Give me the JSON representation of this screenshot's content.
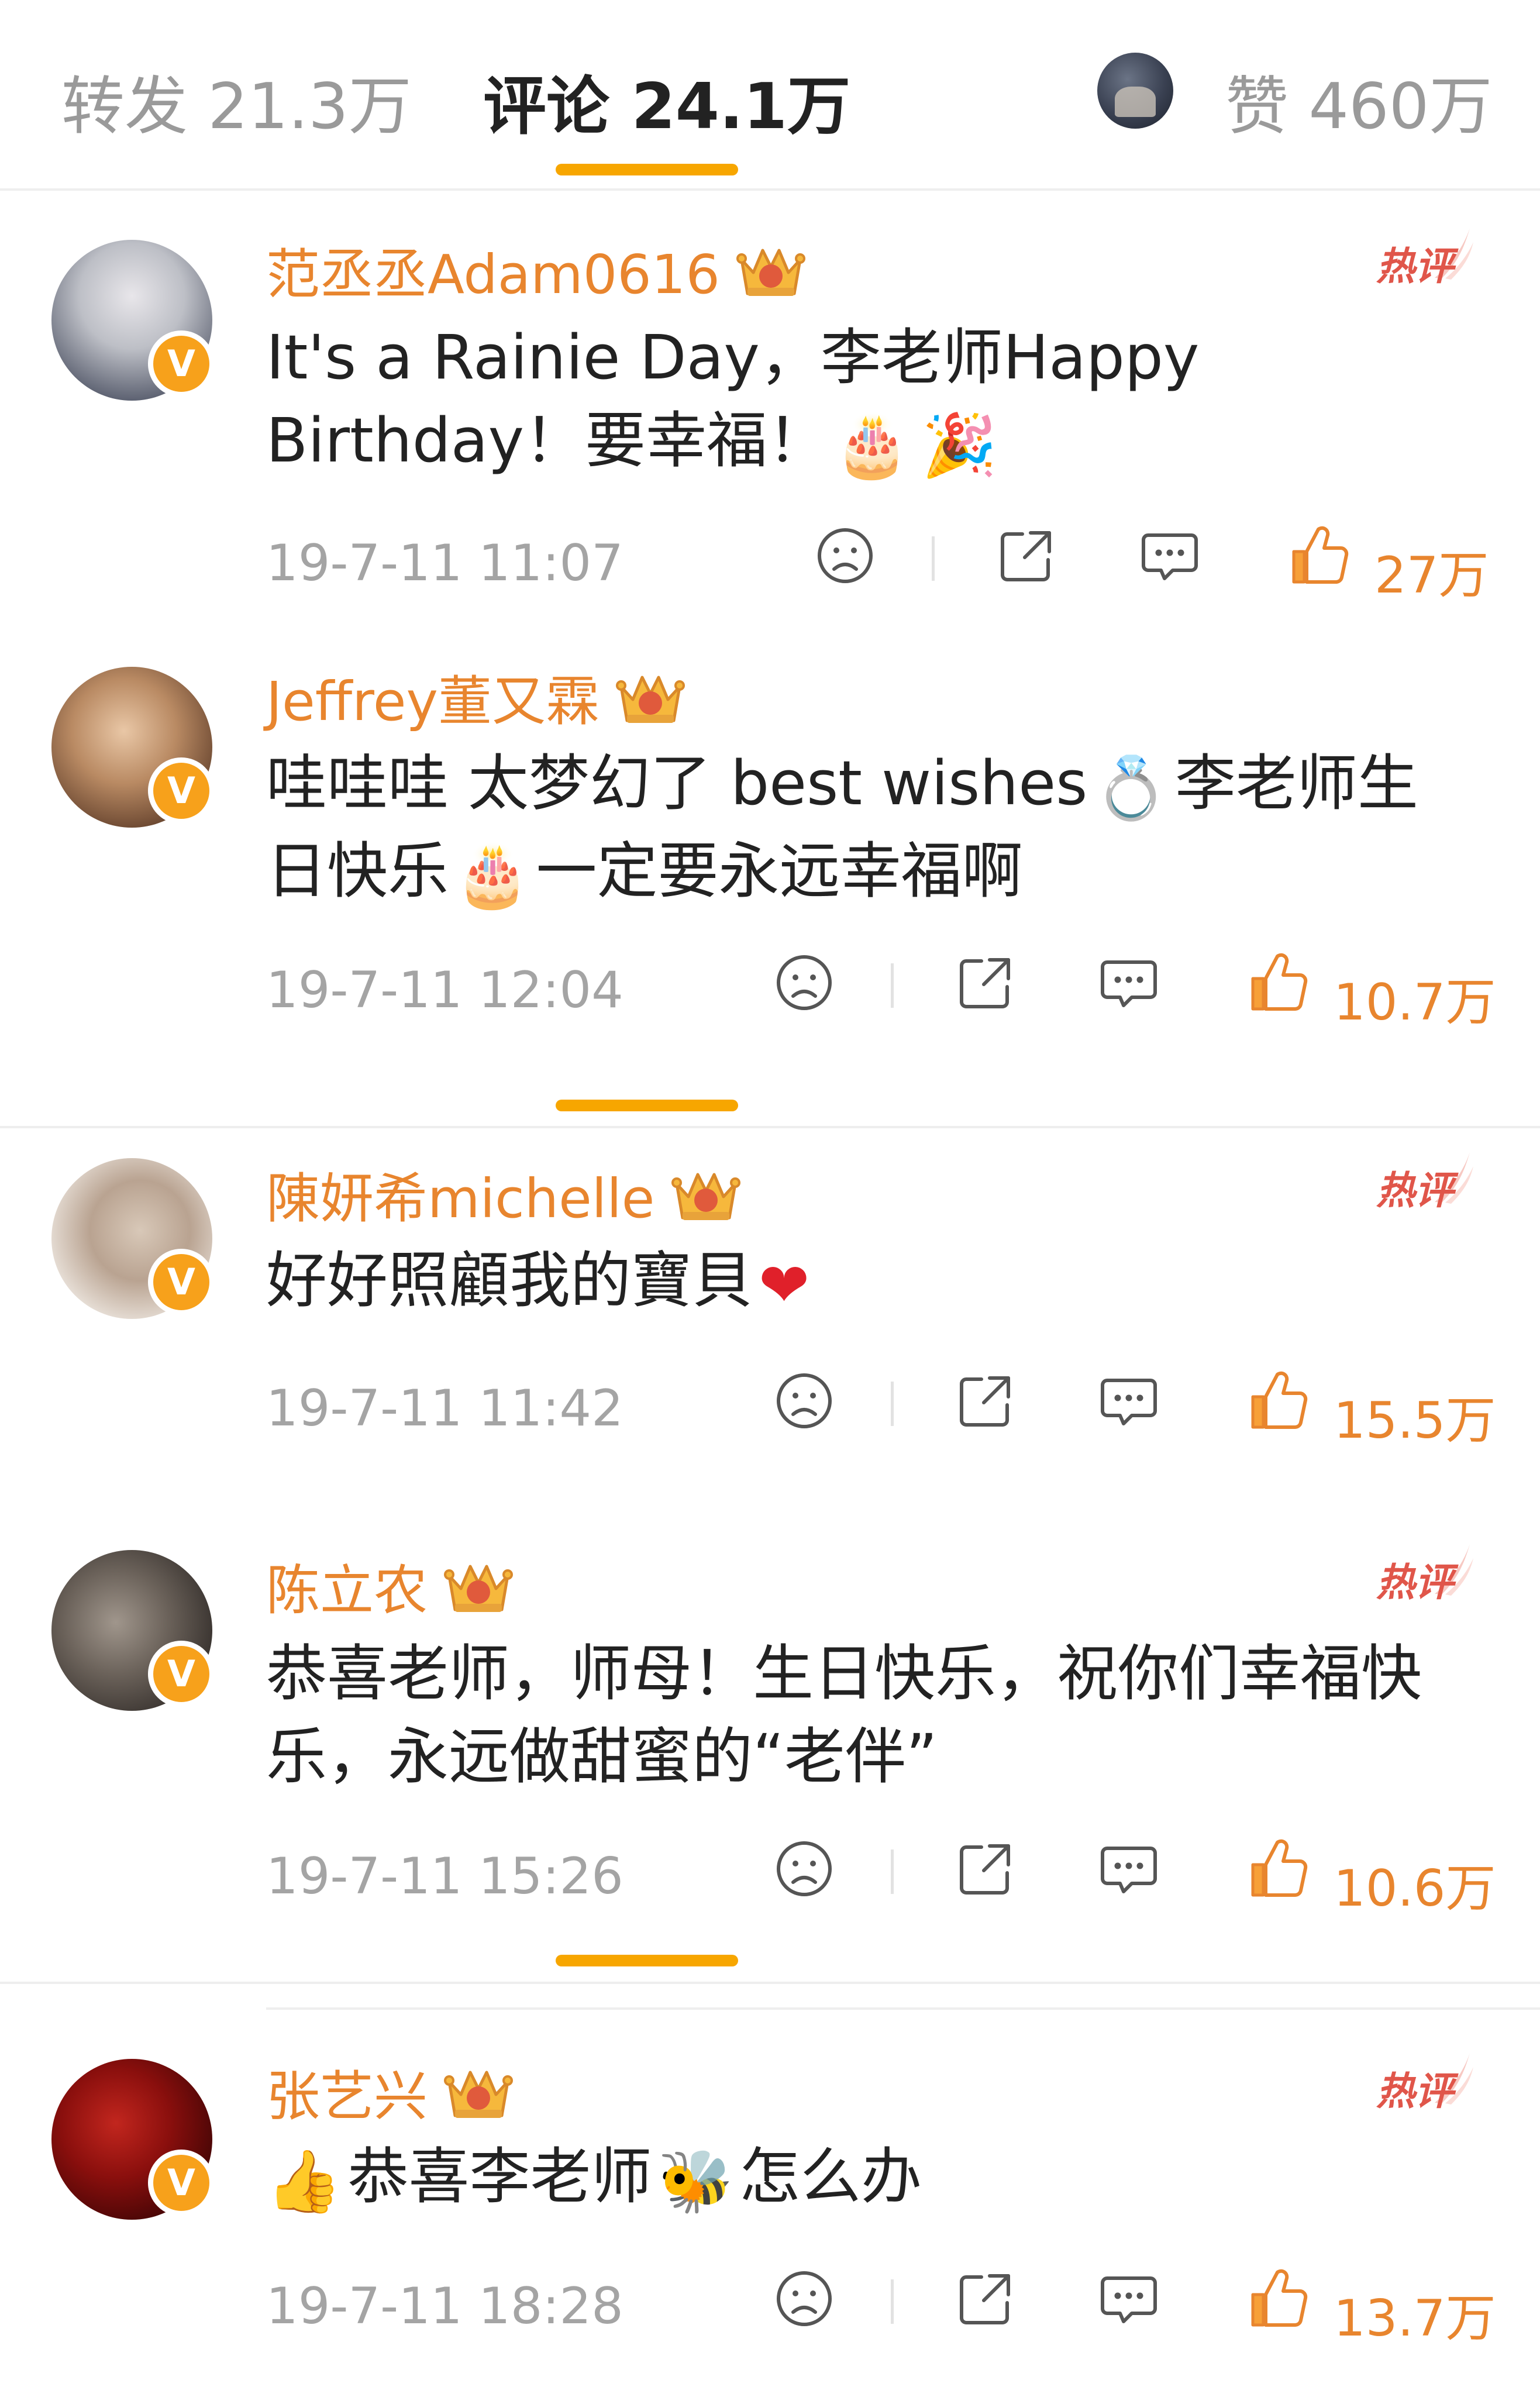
{
  "tabs": {
    "repost": "转发 21.3万",
    "comment": "评论 24.1万",
    "like": "赞 460万"
  },
  "colors": {
    "accent": "#f7a600",
    "username": "#e8852e",
    "hot": "#e0564a"
  },
  "hot_label": "热评",
  "comments": [
    {
      "username": "范丞丞Adam0616",
      "crown_level": "9",
      "hot": true,
      "text_line1": "It's a Rainie Day，李老师Happy",
      "text_line2": "Birthday！要幸福！",
      "emojis": [
        "cake-emoji",
        "party-popper-emoji"
      ],
      "time": "19-7-11 11:07",
      "likes": "27万"
    },
    {
      "username": "Jeffrey董又霖",
      "crown_level": "7",
      "hot": false,
      "text_line1": "哇哇哇 太梦幻了 best wishes",
      "text_line1b": "李老师生",
      "text_line2a": "日快乐",
      "text_line2b": "一定要永远幸福啊",
      "emojis": [
        "ring-emoji",
        "cake-emoji"
      ],
      "time": "19-7-11 12:04",
      "likes": "10.7万"
    },
    {
      "username": "陳妍希michelle",
      "crown_level": "7",
      "hot": true,
      "text_line1": "好好照顧我的寶貝",
      "emojis": [
        "heart-emoji"
      ],
      "time": "19-7-11 11:42",
      "likes": "15.5万"
    },
    {
      "username": "陈立农",
      "crown_level": "9",
      "hot": true,
      "text_line1": "恭喜老师，师母！生日快乐，祝你们幸福快",
      "text_line2": "乐，永远做甜蜜的“老伴”",
      "time": "19-7-11 15:26",
      "likes": "10.6万"
    },
    {
      "username": "张艺兴",
      "crown_level": "10",
      "hot": true,
      "text_line1a": "恭喜李老师",
      "text_line1b": "怎么办",
      "emojis": [
        "thumbs-up-emoji",
        "bee-emoji"
      ],
      "time": "19-7-11 18:28",
      "likes": "13.7万"
    }
  ]
}
